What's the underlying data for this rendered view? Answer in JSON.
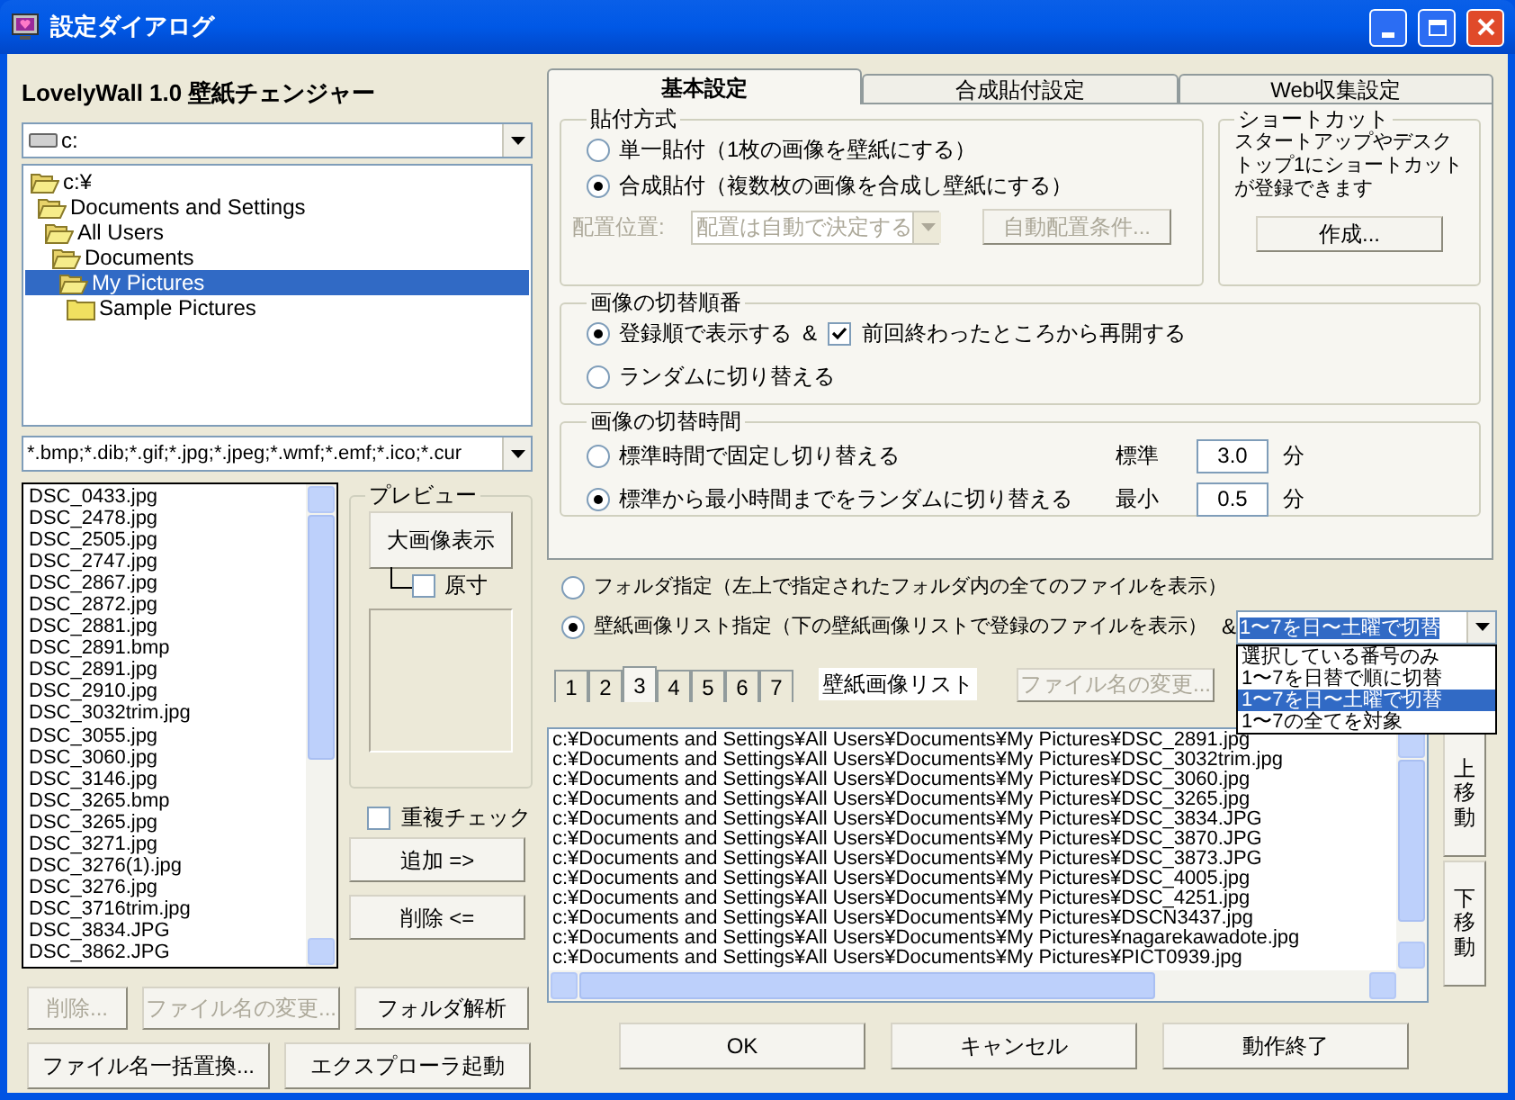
{
  "window": {
    "title": "設定ダイアログ"
  },
  "app_heading": "LovelyWall 1.0 壁紙チェンジャー",
  "drive_combo": {
    "value": "c:"
  },
  "folder_tree": [
    {
      "label": "c:¥",
      "expanded": true,
      "selected": false,
      "children": [
        {
          "label": "Documents and Settings",
          "expanded": true,
          "selected": false,
          "children": [
            {
              "label": "All Users",
              "expanded": true,
              "selected": false,
              "children": [
                {
                  "label": "Documents",
                  "expanded": true,
                  "selected": false,
                  "children": [
                    {
                      "label": "My Pictures",
                      "expanded": true,
                      "selected": true,
                      "children": [
                        {
                          "label": "Sample Pictures",
                          "expanded": false,
                          "selected": false
                        }
                      ]
                    }
                  ]
                }
              ]
            }
          ]
        }
      ]
    }
  ],
  "filter_combo": {
    "value": "*.bmp;*.dib;*.gif;*.jpg;*.jpeg;*.wmf;*.emf;*.ico;*.cur"
  },
  "file_list": [
    "DSC_0433.jpg",
    "DSC_2478.jpg",
    "DSC_2505.jpg",
    "DSC_2747.jpg",
    "DSC_2867.jpg",
    "DSC_2872.jpg",
    "DSC_2881.jpg",
    "DSC_2891.bmp",
    "DSC_2891.jpg",
    "DSC_2910.jpg",
    "DSC_3032trim.jpg",
    "DSC_3055.jpg",
    "DSC_3060.jpg",
    "DSC_3146.jpg",
    "DSC_3265.bmp",
    "DSC_3265.jpg",
    "DSC_3271.jpg",
    "DSC_3276(1).jpg",
    "DSC_3276.jpg",
    "DSC_3716trim.jpg",
    "DSC_3834.JPG",
    "DSC_3862.JPG"
  ],
  "preview": {
    "title": "プレビュー",
    "large_button": "大画像表示",
    "actual_size": {
      "label": "原寸",
      "checked": false
    }
  },
  "duplicate_check": {
    "label": "重複チェック",
    "checked": false
  },
  "add_button": "追加 =>",
  "remove_button": "削除 <=",
  "left_buttons": [
    {
      "label": "削除...",
      "disabled": true
    },
    {
      "label": "ファイル名の変更...",
      "disabled": true
    },
    {
      "label": "フォルダ解析",
      "disabled": false
    }
  ],
  "left_bottom_buttons": [
    "ファイル名一括置換...",
    "エクスプローラ起動"
  ],
  "tabs": [
    {
      "label": "基本設定",
      "selected": true
    },
    {
      "label": "合成貼付設定",
      "selected": false
    },
    {
      "label": "Web収集設定",
      "selected": false
    }
  ],
  "paste_method": {
    "title": "貼付方式",
    "options": [
      {
        "label": "単一貼付（1枚の画像を壁紙にする）",
        "selected": false
      },
      {
        "label": "合成貼付（複数枚の画像を合成し壁紙にする）",
        "selected": true
      }
    ],
    "placement": {
      "label": "配置位置:",
      "value": "配置は自動で決定する",
      "disabled": true
    },
    "auto_button": {
      "label": "自動配置条件...",
      "disabled": true
    }
  },
  "shortcut": {
    "title": "ショートカット",
    "text": "スタートアップやデスクトップ1にショートカットが登録できます",
    "button": "作成..."
  },
  "switch_order": {
    "title": "画像の切替順番",
    "options": [
      {
        "label": "登録順で表示する",
        "selected": true
      },
      {
        "label": "ランダムに切り替える",
        "selected": false
      }
    ],
    "amp": "&",
    "resume": {
      "label": "前回終わったところから再開する",
      "checked": true
    }
  },
  "switch_time": {
    "title": "画像の切替時間",
    "options": [
      {
        "label": "標準時間で固定し切り替える",
        "selected": false
      },
      {
        "label": "標準から最小時間までをランダムに切り替える",
        "selected": true
      }
    ],
    "fields": [
      {
        "label": "標準",
        "value": "3.0",
        "unit": "分"
      },
      {
        "label": "最小",
        "value": "0.5",
        "unit": "分"
      }
    ]
  },
  "source": {
    "options": [
      {
        "label": "フォルダ指定（左上で指定されたフォルダ内の全てのファイルを表示）",
        "selected": false
      },
      {
        "label": "壁紙画像リスト指定（下の壁紙画像リストで登録のファイルを表示）",
        "selected": true
      }
    ],
    "amp": "&",
    "mode_combo": {
      "value": "1〜7を日〜土曜で切替",
      "open": true,
      "options": [
        {
          "label": "選択している番号のみ",
          "selected": false
        },
        {
          "label": "1〜7を日替で順に切替",
          "selected": false
        },
        {
          "label": "1〜7を日〜土曜で切替",
          "selected": true
        },
        {
          "label": "1〜7の全てを対象",
          "selected": false
        }
      ]
    }
  },
  "list_tabs": [
    {
      "label": "1",
      "selected": false
    },
    {
      "label": "2",
      "selected": false
    },
    {
      "label": "3",
      "selected": true
    },
    {
      "label": "4",
      "selected": false
    },
    {
      "label": "5",
      "selected": false
    },
    {
      "label": "6",
      "selected": false
    },
    {
      "label": "7",
      "selected": false
    }
  ],
  "list_label": "壁紙画像リスト",
  "rename_button": {
    "label": "ファイル名の変更...",
    "disabled": true
  },
  "path_list": [
    "c:¥Documents and Settings¥All Users¥Documents¥My Pictures¥DSC_2891.jpg",
    "c:¥Documents and Settings¥All Users¥Documents¥My Pictures¥DSC_3032trim.jpg",
    "c:¥Documents and Settings¥All Users¥Documents¥My Pictures¥DSC_3060.jpg",
    "c:¥Documents and Settings¥All Users¥Documents¥My Pictures¥DSC_3265.jpg",
    "c:¥Documents and Settings¥All Users¥Documents¥My Pictures¥DSC_3834.JPG",
    "c:¥Documents and Settings¥All Users¥Documents¥My Pictures¥DSC_3870.JPG",
    "c:¥Documents and Settings¥All Users¥Documents¥My Pictures¥DSC_3873.JPG",
    "c:¥Documents and Settings¥All Users¥Documents¥My Pictures¥DSC_4005.jpg",
    "c:¥Documents and Settings¥All Users¥Documents¥My Pictures¥DSC_4251.jpg",
    "c:¥Documents and Settings¥All Users¥Documents¥My Pictures¥DSCN3437.jpg",
    "c:¥Documents and Settings¥All Users¥Documents¥My Pictures¥nagarekawadote.jpg",
    "c:¥Documents and Settings¥All Users¥Documents¥My Pictures¥PICT0939.jpg"
  ],
  "move_buttons": [
    "上移動",
    "下移動"
  ],
  "footer_buttons": [
    "OK",
    "キャンセル",
    "動作終了"
  ]
}
